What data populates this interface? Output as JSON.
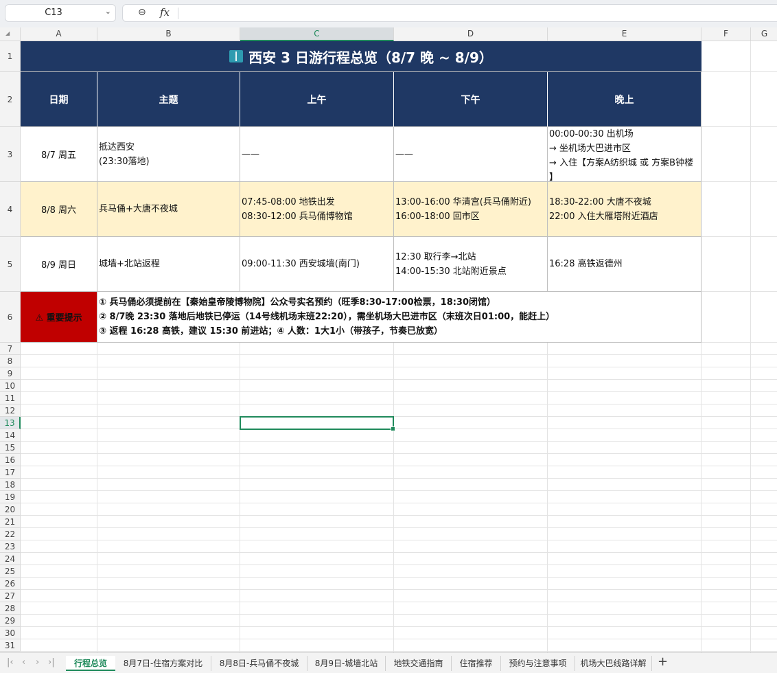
{
  "formula_bar": {
    "cell_ref": "C13",
    "fx_label": "fx",
    "formula": ""
  },
  "columns": [
    "A",
    "B",
    "C",
    "D",
    "E",
    "F",
    "G"
  ],
  "rows": [
    "1",
    "2",
    "3",
    "4",
    "5",
    "6",
    "7",
    "8",
    "9",
    "10",
    "11",
    "12",
    "13",
    "14",
    "15",
    "16",
    "17",
    "18",
    "19",
    "20",
    "21",
    "22",
    "23",
    "24",
    "25",
    "26",
    "27",
    "28",
    "29",
    "30",
    "31"
  ],
  "sheet": {
    "title": "西安 3 日游行程总览（8/7 晚 ~ 8/9）",
    "headers": [
      "日期",
      "主题",
      "上午",
      "下午",
      "晚上"
    ],
    "rows": [
      {
        "date": "8/7 周五",
        "theme": [
          "抵达西安",
          "(23:30落地)"
        ],
        "morning": [
          "——"
        ],
        "afternoon": [
          "——"
        ],
        "evening": [
          "00:00-00:30 出机场",
          "→ 坐机场大巴进市区",
          "→ 入住【方案A纺织城 或 方案B钟楼",
          "】"
        ]
      },
      {
        "date": "8/8 周六",
        "theme": [
          "兵马俑+大唐不夜城"
        ],
        "morning": [
          "07:45-08:00 地铁出发",
          "08:30-12:00 兵马俑博物馆"
        ],
        "afternoon": [
          "13:00-16:00 华清宫(兵马俑附近)",
          "16:00-18:00 回市区"
        ],
        "evening": [
          "18:30-22:00 大唐不夜城",
          "22:00 入住大雁塔附近酒店"
        ]
      },
      {
        "date": "8/9 周日",
        "theme": [
          "城墙+北站返程"
        ],
        "morning": [
          "09:00-11:30 西安城墙(南门)"
        ],
        "afternoon": [
          "12:30 取行李→北站",
          "14:00-15:30 北站附近景点"
        ],
        "evening": [
          "16:28 高铁返德州"
        ]
      }
    ],
    "warning_label": "⚠ 重要提示",
    "notes": [
      "① 兵马俑必须提前在【秦始皇帝陵博物院】公众号实名预约（旺季8:30-17:00检票，18:30闭馆）",
      "② 8/7晚 23:30 落地后地铁已停运（14号线机场末班22:20），需坐机场大巴进市区（末班次日01:00，能赶上）",
      "③ 返程 16:28 高铁，建议 15:30 前进站；④ 人数：1大1小（带孩子，节奏已放宽）"
    ]
  },
  "tabs": [
    "行程总览",
    "8月7日-住宿方案对比",
    "8月8日-兵马俑不夜城",
    "8月9日-城墙北站",
    "地铁交通指南",
    "住宿推荐",
    "预约与注意事项",
    "机场大巴线路详解"
  ],
  "active_tab": "行程总览",
  "colors": {
    "header_bg": "#1f3864",
    "highlight_row": "#fff2cc",
    "warning_bg": "#c00000",
    "selection": "#1f8a5b"
  },
  "icons": [
    "book-icon",
    "zoom-icon",
    "fx-icon",
    "chevron-down-icon",
    "add-sheet-icon"
  ]
}
